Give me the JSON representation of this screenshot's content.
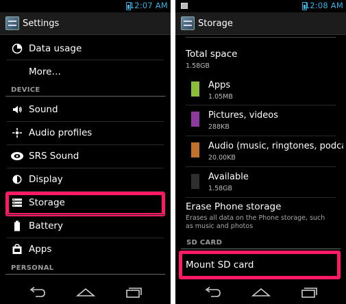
{
  "left_screen": {
    "status_time": "12:07",
    "status_ampm": "AM",
    "title": "Settings",
    "items": [
      {
        "label": "Data usage",
        "icon": "data-usage-icon"
      },
      {
        "label": "More…",
        "icon": ""
      }
    ],
    "device_header": "DEVICE",
    "device_items": [
      {
        "label": "Sound",
        "icon": "speaker-icon"
      },
      {
        "label": "Audio profiles",
        "icon": "audio-profiles-icon"
      },
      {
        "label": "SRS Sound",
        "icon": "srs-icon"
      },
      {
        "label": "Display",
        "icon": "brightness-icon"
      },
      {
        "label": "Storage",
        "icon": "storage-icon"
      },
      {
        "label": "Battery",
        "icon": "battery-icon"
      },
      {
        "label": "Apps",
        "icon": "apps-icon"
      }
    ],
    "personal_header": "PERSONAL"
  },
  "right_screen": {
    "status_time": "12:08",
    "status_ampm": "AM",
    "title": "Storage",
    "total_title": "Total space",
    "total_value": "1.58GB",
    "entries": [
      {
        "label": "Apps",
        "value": "1.05MB",
        "color": "#8bbd3a"
      },
      {
        "label": "Pictures, videos",
        "value": "288KB",
        "color": "#8e3a9c"
      },
      {
        "label": "Audio (music, ringtones, podcasts, etc.)",
        "value": "20.00KB",
        "color": "#c0702a"
      },
      {
        "label": "Available",
        "value": "1.58GB",
        "color": "#2e2e2e"
      }
    ],
    "erase_title": "Erase Phone storage",
    "erase_desc": "Erases all data on the Phone storage, such as music and photos",
    "sd_header": "SD CARD",
    "mount_label": "Mount SD card"
  },
  "highlight_color": "#ff1a66",
  "accent_color": "#33b5e5"
}
